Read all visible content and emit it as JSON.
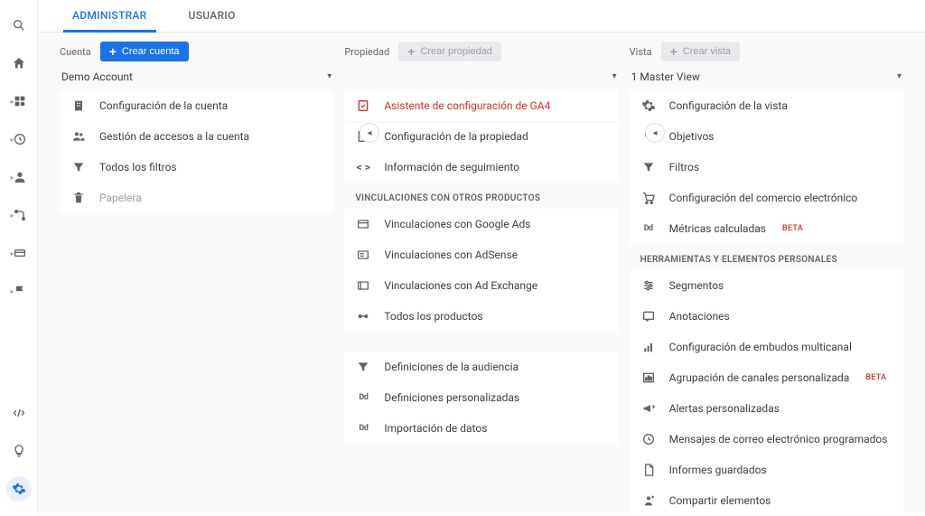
{
  "tabs": {
    "admin": "ADMINISTRAR",
    "user": "USUARIO"
  },
  "columns": {
    "account": {
      "label": "Cuenta",
      "create_btn": "Crear cuenta",
      "selector": "Demo Account",
      "items": [
        {
          "label": "Configuración de la cuenta",
          "icon": "building"
        },
        {
          "label": "Gestión de accesos a la cuenta",
          "icon": "people"
        },
        {
          "label": "Todos los filtros",
          "icon": "filter"
        },
        {
          "label": "Papelera",
          "icon": "trash",
          "disabled": true
        }
      ]
    },
    "property": {
      "label": "Propiedad",
      "create_btn": "Crear propiedad",
      "selector": "",
      "items": [
        {
          "label": "Asistente de configuración de GA4",
          "icon": "check-sheet",
          "active": true
        },
        {
          "label": "Configuración de la propiedad",
          "icon": "sheet"
        },
        {
          "label": "Información de seguimiento",
          "icon": "code"
        }
      ],
      "section1": "VINCULACIONES CON OTROS PRODUCTOS",
      "items2": [
        {
          "label": "Vinculaciones con Google Ads",
          "icon": "ads"
        },
        {
          "label": "Vinculaciones con AdSense",
          "icon": "adsense"
        },
        {
          "label": "Vinculaciones con Ad Exchange",
          "icon": "adx"
        },
        {
          "label": "Todos los productos",
          "icon": "link"
        }
      ],
      "items3": [
        {
          "label": "Definiciones de la audiencia",
          "icon": "filter"
        },
        {
          "label": "Definiciones personalizadas",
          "icon": "dd"
        },
        {
          "label": "Importación de datos",
          "icon": "dd"
        }
      ]
    },
    "view": {
      "label": "Vista",
      "create_btn": "Crear vista",
      "selector": "1 Master View",
      "items": [
        {
          "label": "Configuración de la vista",
          "icon": "gear"
        },
        {
          "label": "Objetivos",
          "icon": "flag"
        },
        {
          "label": "Filtros",
          "icon": "filter"
        },
        {
          "label": "Configuración del comercio electrónico",
          "icon": "cart"
        },
        {
          "label": "Métricas calculadas",
          "icon": "dd",
          "beta": "BETA"
        }
      ],
      "section1": "HERRAMIENTAS Y ELEMENTOS PERSONALES",
      "items2": [
        {
          "label": "Segmentos",
          "icon": "segments"
        },
        {
          "label": "Anotaciones",
          "icon": "annotation"
        },
        {
          "label": "Configuración de embudos multicanal",
          "icon": "funnel-chart"
        },
        {
          "label": "Agrupación de canales personalizada",
          "icon": "group-chart",
          "beta": "BETA"
        },
        {
          "label": "Alertas personalizadas",
          "icon": "megaphone"
        },
        {
          "label": "Mensajes de correo electrónico programados",
          "icon": "clock"
        },
        {
          "label": "Informes guardados",
          "icon": "report"
        },
        {
          "label": "Compartir elementos",
          "icon": "share"
        }
      ]
    }
  }
}
